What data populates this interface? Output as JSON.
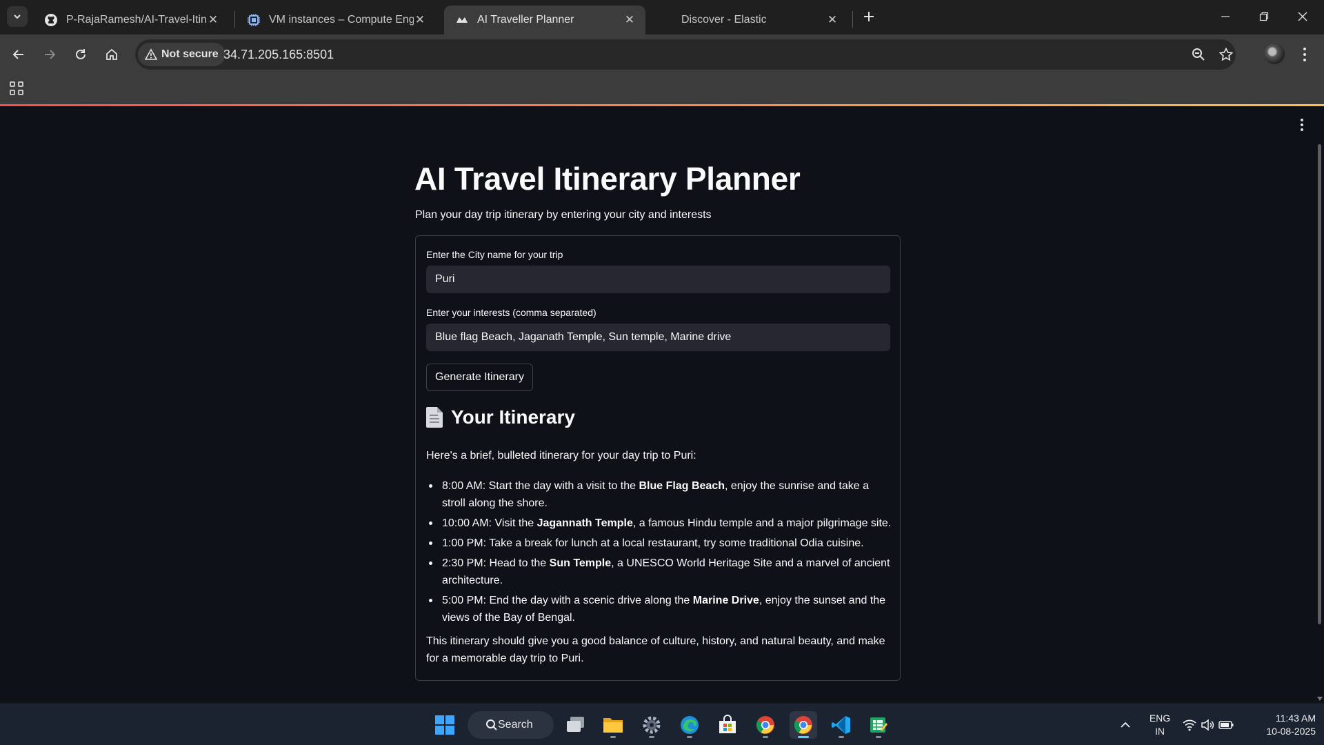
{
  "browser": {
    "tabs": [
      {
        "title": "P-RajaRamesh/AI-Travel-Itinerary",
        "icon": "github-icon",
        "active": false
      },
      {
        "title": "VM instances – Compute Engine",
        "icon": "compute-engine-icon",
        "active": false
      },
      {
        "title": "AI Traveller Planner",
        "icon": "streamlit-icon",
        "active": true
      },
      {
        "title": "Discover - Elastic",
        "icon": "elastic-icon",
        "active": false
      }
    ],
    "security_label": "Not secure",
    "url": "34.71.205.165:8501"
  },
  "app": {
    "title": "AI Travel Itinerary Planner",
    "subtitle": "Plan your day trip itinerary by entering your city and interests",
    "city_label": "Enter the City name for your trip",
    "city_value": "Puri",
    "interests_label": "Enter your interests (comma separated)",
    "interests_value": "Blue flag Beach,  Jaganath Temple, Sun temple, Marine drive",
    "button_label": "Generate Itinerary",
    "itinerary_heading": "Your Itinerary",
    "intro": "Here's a brief, bulleted itinerary for your day trip to Puri:",
    "items": [
      {
        "pre": "8:00 AM: Start the day with a visit to the ",
        "bold": "Blue Flag Beach",
        "post": ", enjoy the sunrise and take a stroll along the shore."
      },
      {
        "pre": "10:00 AM: Visit the ",
        "bold": "Jagannath Temple",
        "post": ", a famous Hindu temple and a major pilgrimage site."
      },
      {
        "pre": "1:00 PM: Take a break for lunch at a local restaurant, try some traditional Odia cuisine.",
        "bold": "",
        "post": ""
      },
      {
        "pre": "2:30 PM: Head to the ",
        "bold": "Sun Temple",
        "post": ", a UNESCO World Heritage Site and a marvel of ancient architecture."
      },
      {
        "pre": "5:00 PM: End the day with a scenic drive along the ",
        "bold": "Marine Drive",
        "post": ", enjoy the sunset and the views of the Bay of Bengal."
      }
    ],
    "conclusion": "This itinerary should give you a good balance of culture, history, and natural beauty, and make for a memorable day trip to Puri."
  },
  "taskbar": {
    "search_label": "Search",
    "language": "ENG",
    "region": "IN",
    "time": "11:43 AM",
    "date": "10-08-2025"
  },
  "colors": {
    "page_bg": "#0e1117",
    "input_bg": "#262730",
    "accent_gradient_start": "#ff4b4b",
    "accent_gradient_end": "#ffbd45"
  }
}
